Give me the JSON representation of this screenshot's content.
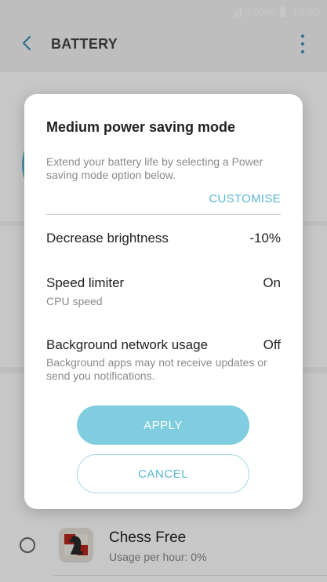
{
  "status_bar": {
    "battery_percent": "100%",
    "time": "10:00"
  },
  "app_bar": {
    "title": "BATTERY"
  },
  "dialog": {
    "title": "Medium power saving mode",
    "description": "Extend your battery life by selecting a Power saving mode option below.",
    "customise_label": "CUSTOMISE",
    "rows": [
      {
        "label": "Decrease brightness",
        "value": "-10%",
        "sub": ""
      },
      {
        "label": "Speed limiter",
        "value": "On",
        "sub": "CPU speed"
      },
      {
        "label": "Background network usage",
        "value": "Off",
        "sub": "Background apps may not receive updates or send you notifications."
      }
    ],
    "apply_label": "APPLY",
    "cancel_label": "CANCEL"
  },
  "app_list": [
    {
      "name": "Chess Free",
      "usage": "Usage per hour: 0%"
    }
  ],
  "colors": {
    "accent": "#5bb8d0",
    "apply_bg": "#80cde0"
  }
}
